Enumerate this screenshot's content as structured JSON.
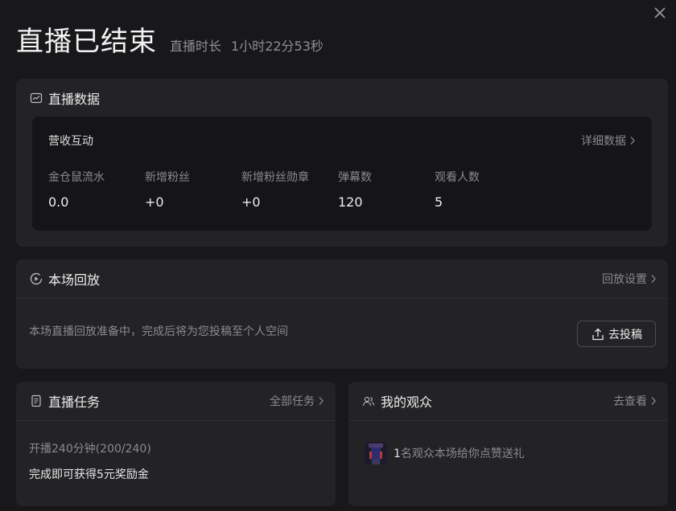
{
  "header": {
    "title": "直播已结束",
    "duration_label": "直播时长",
    "duration_value": "1小时22分53秒"
  },
  "data_card": {
    "title": "直播数据",
    "inner_title": "营收互动",
    "detail_link": "详细数据",
    "metrics": [
      {
        "label": "金仓鼠流水",
        "value": "0.0"
      },
      {
        "label": "新增粉丝",
        "value": "+0"
      },
      {
        "label": "新增粉丝勋章",
        "value": "+0"
      },
      {
        "label": "弹幕数",
        "value": "120"
      },
      {
        "label": "观看人数",
        "value": "5"
      }
    ]
  },
  "replay_card": {
    "title": "本场回放",
    "settings_link": "回放设置",
    "description": "本场直播回放准备中，完成后将为您投稿至个人空间",
    "upload_button": "去投稿"
  },
  "task_card": {
    "title": "直播任务",
    "all_link": "全部任务",
    "progress": "开播240分钟(200/240)",
    "reward": "完成即可获得5元奖励金"
  },
  "audience_card": {
    "title": "我的观众",
    "view_link": "去查看",
    "count": "1",
    "summary": "名观众本场给你点赞送礼"
  }
}
